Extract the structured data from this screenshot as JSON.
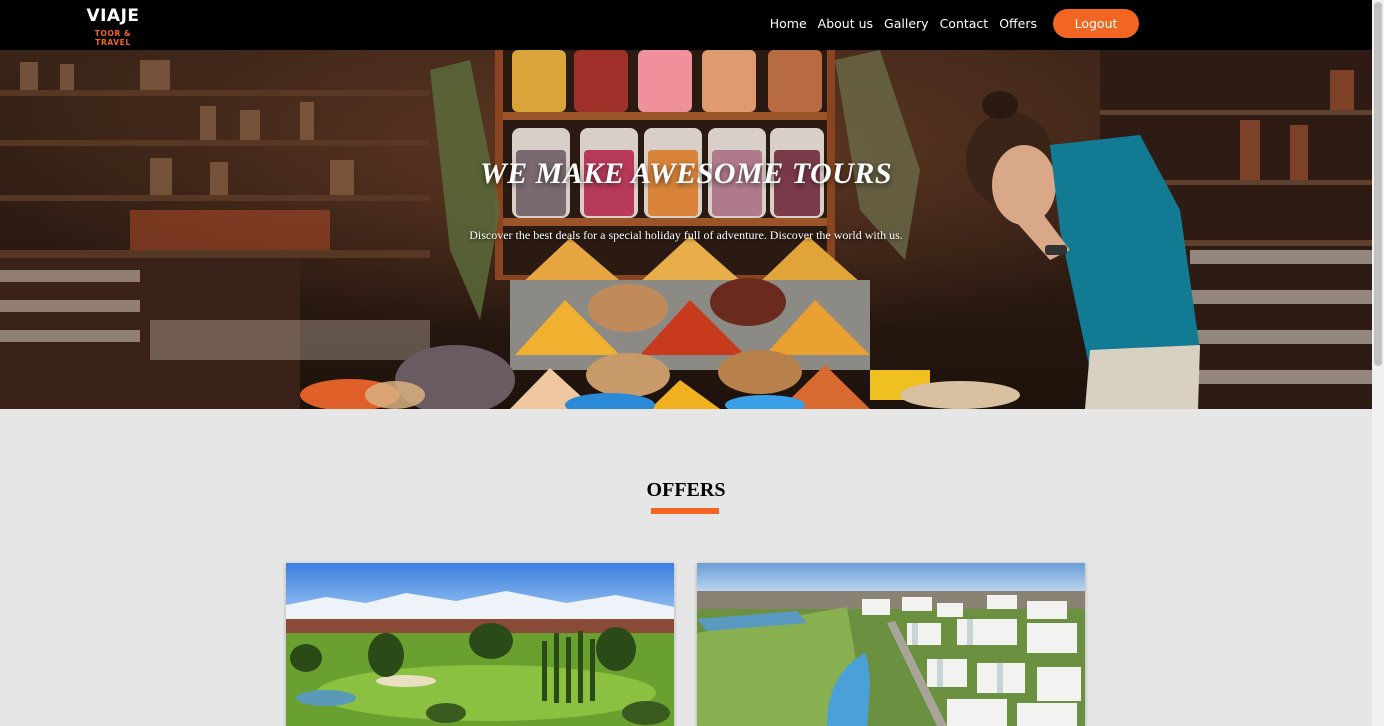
{
  "brand": {
    "name": "VIAJE",
    "tagline": "TOOR & TRAVEL"
  },
  "nav": {
    "links": [
      "Home",
      "About us",
      "Gallery",
      "Contact",
      "Offers"
    ],
    "logout_label": "Logout"
  },
  "hero": {
    "title": "WE MAKE AWESOME TOURS",
    "subtitle": "Discover the best deals for a special holiday full of adventure. Discover the world with us."
  },
  "offers": {
    "title": "OFFERS"
  },
  "colors": {
    "accent": "#f26522",
    "navbar": "#000000",
    "page_bg": "#e6e6e6"
  }
}
